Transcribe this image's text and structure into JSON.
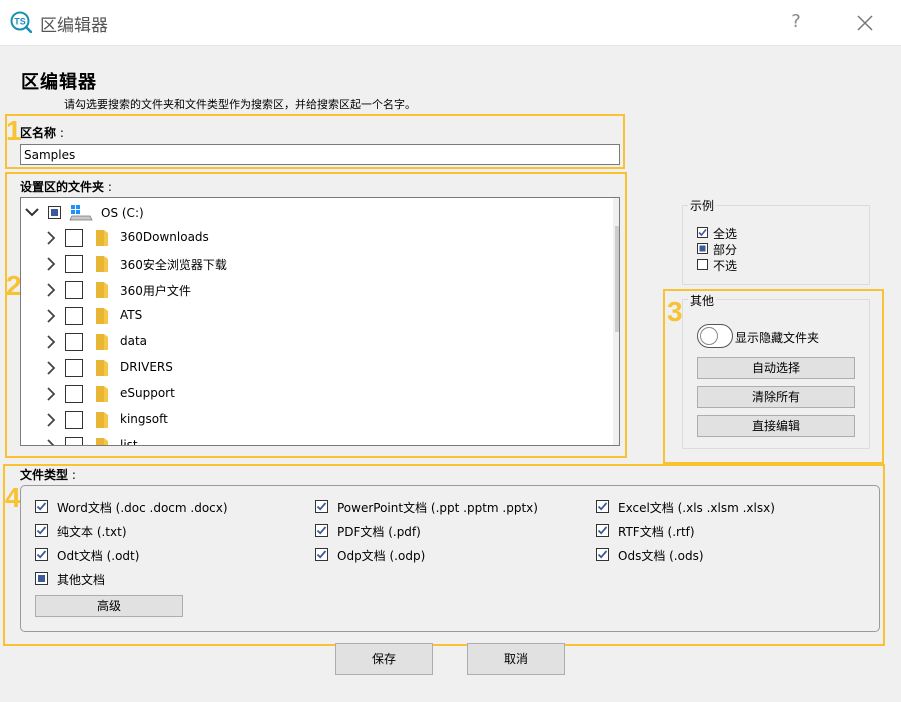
{
  "window": {
    "title": "区编辑器",
    "help": "?",
    "app_icon": "ts-logo-icon"
  },
  "header": {
    "title": "区编辑器",
    "description": "请勾选要搜索的文件夹和文件类型作为搜索区，并给搜索区起一个名字。"
  },
  "steps": [
    "1",
    "2",
    "3",
    "4"
  ],
  "zone_name": {
    "label": "区名称",
    "value": "Samples"
  },
  "folders": {
    "label": "设置区的文件夹",
    "root": {
      "label": "OS (C:)",
      "state": "partial",
      "expanded": true
    },
    "items": [
      {
        "label": "360Downloads"
      },
      {
        "label": "360安全浏览器下载"
      },
      {
        "label": "360用户文件"
      },
      {
        "label": "ATS"
      },
      {
        "label": "data"
      },
      {
        "label": "DRIVERS"
      },
      {
        "label": "eSupport"
      },
      {
        "label": "kingsoft"
      },
      {
        "label": "list"
      }
    ]
  },
  "legend": {
    "title": "示例",
    "items": [
      {
        "label": "全选",
        "state": "checked"
      },
      {
        "label": "部分",
        "state": "partial"
      },
      {
        "label": "不选",
        "state": "unchecked"
      }
    ]
  },
  "other": {
    "title": "其他",
    "show_hidden_label": "显示隐藏文件夹",
    "show_hidden_on": false,
    "auto_select": "自动选择",
    "clear_all": "清除所有",
    "direct_edit": "直接编辑"
  },
  "file_types": {
    "label": "文件类型",
    "items": [
      {
        "label": "Word文档 (.doc .docm .docx)",
        "state": "checked"
      },
      {
        "label": "PowerPoint文档 (.ppt .pptm .pptx)",
        "state": "checked"
      },
      {
        "label": "Excel文档 (.xls .xlsm .xlsx)",
        "state": "checked"
      },
      {
        "label": "纯文本 (.txt)",
        "state": "checked"
      },
      {
        "label": "PDF文档 (.pdf)",
        "state": "checked"
      },
      {
        "label": "RTF文档 (.rtf)",
        "state": "checked"
      },
      {
        "label": "Odt文档 (.odt)",
        "state": "checked"
      },
      {
        "label": "Odp文档 (.odp)",
        "state": "checked"
      },
      {
        "label": "Ods文档 (.ods)",
        "state": "checked"
      },
      {
        "label": "其他文档",
        "state": "partial"
      }
    ],
    "advanced": "高级"
  },
  "footer": {
    "save": "保存",
    "cancel": "取消"
  },
  "colors": {
    "highlight": "#f8c233",
    "checkbox_fill": "#3c5a99",
    "folder": "#f6c646"
  }
}
